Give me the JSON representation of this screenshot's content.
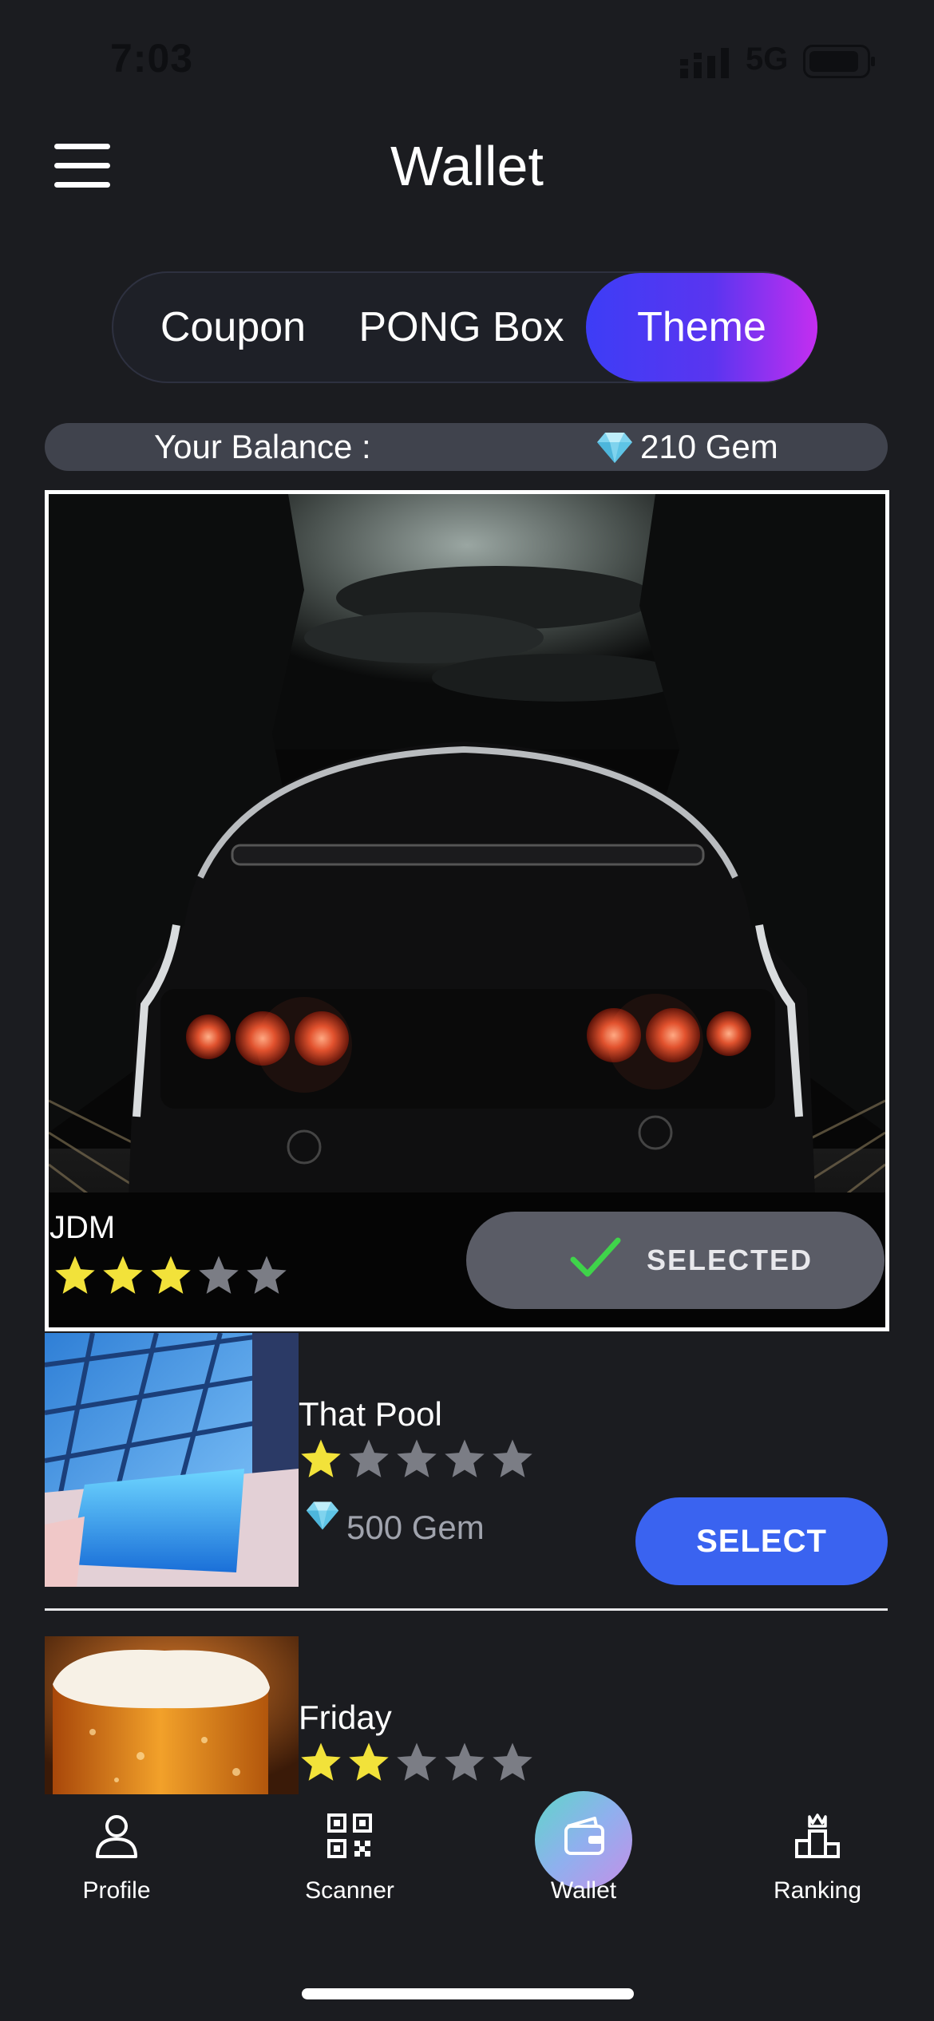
{
  "status_bar": {
    "time": "7:03",
    "network": "5G"
  },
  "header": {
    "title": "Wallet"
  },
  "tabs": [
    {
      "label": "Coupon",
      "active": false
    },
    {
      "label": "PONG Box",
      "active": false
    },
    {
      "label": "Theme",
      "active": true
    }
  ],
  "balance": {
    "label": "Your Balance :",
    "value": "210 Gem"
  },
  "themes": [
    {
      "name": "JDM",
      "rating": 3,
      "max_rating": 5,
      "status_label": "SELECTED"
    },
    {
      "name": "That Pool",
      "rating": 1,
      "max_rating": 5,
      "price": "500 Gem",
      "action_label": "SELECT"
    },
    {
      "name": "Friday",
      "rating": 2,
      "max_rating": 5
    }
  ],
  "bottom_nav": [
    {
      "label": "Profile",
      "icon": "person-icon",
      "active": false
    },
    {
      "label": "Scanner",
      "icon": "qr-code-icon",
      "active": false
    },
    {
      "label": "Wallet",
      "icon": "wallet-icon",
      "active": true
    },
    {
      "label": "Ranking",
      "icon": "podium-crown-icon",
      "active": false
    }
  ],
  "colors": {
    "background": "#1b1c20",
    "accent_blue": "#3a63f0",
    "tab_gradient_start": "#3d3df6",
    "tab_gradient_end": "#c42ef0",
    "star_filled": "#f2e23a",
    "star_empty": "#7b7d85",
    "check": "#3fd44a"
  }
}
